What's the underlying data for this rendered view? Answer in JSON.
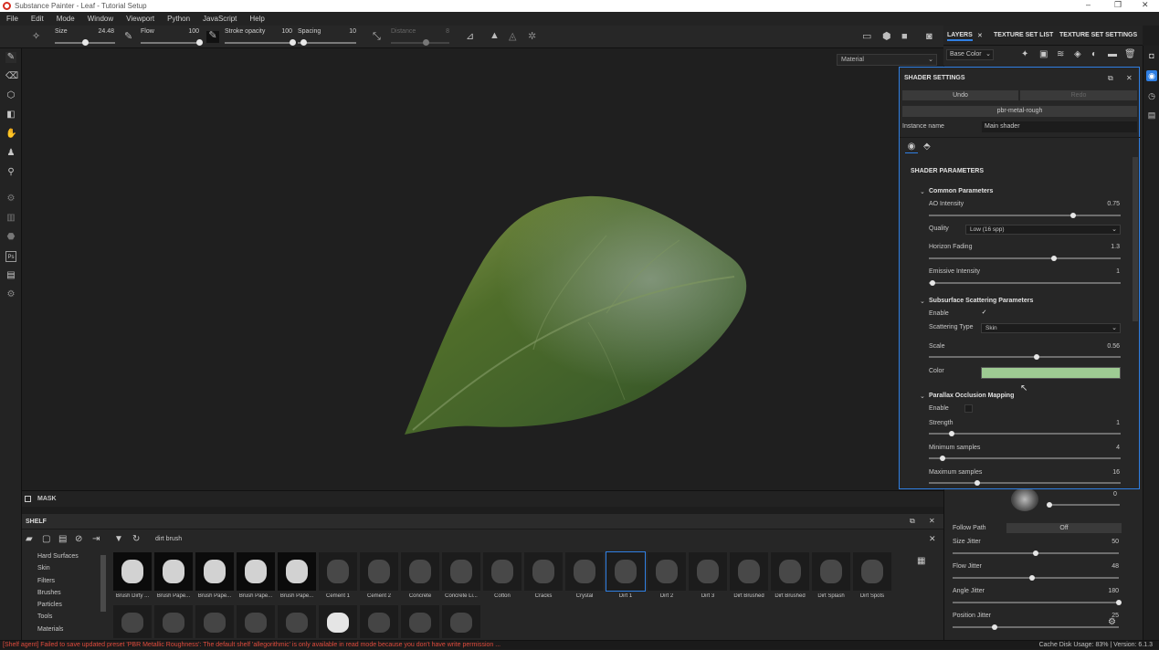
{
  "app": {
    "title": "Substance Painter - Leaf - Tutorial Setup",
    "window_controls": [
      "–",
      "❐",
      "✕"
    ]
  },
  "menu": [
    "File",
    "Edit",
    "Mode",
    "Window",
    "Viewport",
    "Python",
    "JavaScript",
    "Help"
  ],
  "toolbar": {
    "size_label": "Size",
    "size_value": "24.48",
    "size_level": 0.5,
    "flow_label": "Flow",
    "flow_value": "100",
    "flow_level": 1.0,
    "stroke_opacity_label": "Stroke opacity",
    "stroke_opacity_value": "100",
    "stroke_opacity_level": 1.0,
    "spacing_label": "Spacing",
    "spacing_value": "10",
    "spacing_level": 0.1,
    "distance_label": "Distance",
    "distance_value": "8",
    "distance_level": 0.6
  },
  "left_tools": [
    "paint-brush-icon",
    "eraser-icon",
    "projection-icon",
    "geometry-mask-icon",
    "smudge-icon",
    "clone-icon",
    "color-picker-icon",
    "bake-icon",
    "fill-icon",
    "polygon-fill-icon",
    "photoshop-export-icon",
    "document-icon",
    "settings-cog-icon"
  ],
  "viewport": {
    "material_dropdown": "Material"
  },
  "mask": {
    "label": "MASK"
  },
  "shelf": {
    "title": "SHELF",
    "search_value": "dirt brush",
    "categories": [
      "Hard Surfaces",
      "Skin",
      "Filters",
      "Brushes",
      "Particles",
      "Tools",
      "Materials"
    ],
    "items": [
      {
        "label": "Brush Dirty ...",
        "selected": false
      },
      {
        "label": "Brush Pape...",
        "selected": false
      },
      {
        "label": "Brush Pape...",
        "selected": false
      },
      {
        "label": "Brush Pape...",
        "selected": false
      },
      {
        "label": "Brush Pape...",
        "selected": false
      },
      {
        "label": "Cement 1",
        "selected": false
      },
      {
        "label": "Cement 2",
        "selected": false
      },
      {
        "label": "Concrete",
        "selected": false
      },
      {
        "label": "Concrete Li...",
        "selected": false
      },
      {
        "label": "Cotton",
        "selected": false
      },
      {
        "label": "Cracks",
        "selected": false
      },
      {
        "label": "Crystal",
        "selected": false
      },
      {
        "label": "Dirt 1",
        "selected": true
      },
      {
        "label": "Dirt 2",
        "selected": false
      },
      {
        "label": "Dirt 3",
        "selected": false
      },
      {
        "label": "Dirt Brushed",
        "selected": false
      },
      {
        "label": "Dirt Brushed",
        "selected": false
      },
      {
        "label": "Dirt Splash",
        "selected": false
      },
      {
        "label": "Dirt Spots",
        "selected": false
      }
    ]
  },
  "status": {
    "error": "[Shelf agent] Failed to save updated preset 'PBR Metallic Roughness': The default shelf 'allegorithmic' is only available in read mode because you don't have write permission ...",
    "info": "Cache Disk Usage:   83% | Version: 6.1.3"
  },
  "right_panel": {
    "tabs": [
      "LAYERS",
      "TEXTURE SET LIST",
      "TEXTURE SET SETTINGS"
    ],
    "tab_close": "✕",
    "channel_dropdown": "Base Color",
    "follow_path_label": "Follow Path",
    "follow_path_value": "Off",
    "angle_readout": "0",
    "params": [
      {
        "label": "Size Jitter",
        "value": "50",
        "level": 0.5
      },
      {
        "label": "Flow Jitter",
        "value": "48",
        "level": 0.48
      },
      {
        "label": "Angle Jitter",
        "value": "180",
        "level": 1.0
      },
      {
        "label": "Position Jitter",
        "value": "25",
        "level": 0.25
      }
    ]
  },
  "shader": {
    "title": "SHADER SETTINGS",
    "undo": "Undo",
    "redo": "Redo",
    "shader_name": "pbr-metal-rough",
    "instance_label": "Instance name",
    "instance_value": "Main shader",
    "params_title": "SHADER PARAMETERS",
    "common_title": "Common Parameters",
    "ao_label": "AO Intensity",
    "ao_value": "0.75",
    "ao_level": 0.75,
    "quality_label": "Quality",
    "quality_value": "Low (16 spp)",
    "horizon_label": "Horizon Fading",
    "horizon_value": "1.3",
    "horizon_level": 0.65,
    "emissive_label": "Emissive Intensity",
    "emissive_value": "1",
    "emissive_level": 0.02,
    "sss_title": "Subsurface Scattering Parameters",
    "sss_enable_label": "Enable",
    "sss_enable": "✓",
    "scattering_label": "Scattering Type",
    "scattering_value": "Skin",
    "scale_label": "Scale",
    "scale_value": "0.56",
    "scale_level": 0.56,
    "color_label": "Color",
    "color_value": "#9ecb93",
    "pom_title": "Parallax Occlusion Mapping",
    "pom_enable_label": "Enable",
    "strength_label": "Strength",
    "strength_value": "1",
    "strength_level": 0.12,
    "minsamp_label": "Minimum samples",
    "minsamp_value": "4",
    "minsamp_level": 0.07,
    "maxsamp_label": "Maximum samples",
    "maxsamp_value": "16",
    "maxsamp_level": 0.25
  },
  "colors": {
    "accent": "#2f7fe3",
    "error": "#e04b3c",
    "panel": "#262626",
    "leaf": "#4f6d2a"
  }
}
